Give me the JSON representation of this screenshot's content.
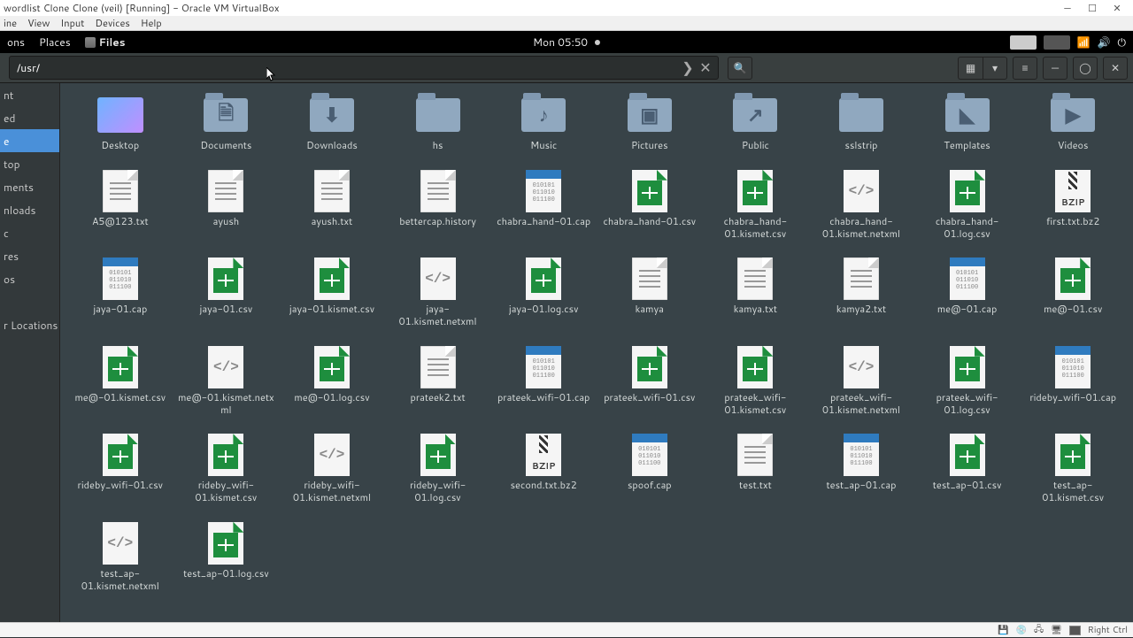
{
  "vb": {
    "title": "wordlist Clone Clone (veil) [Running] - Oracle VM VirtualBox",
    "menus": [
      "ine",
      "View",
      "Input",
      "Devices",
      "Help"
    ],
    "status_right": "Right Ctrl"
  },
  "topbar": {
    "left": [
      "ons",
      "Places",
      "Files"
    ],
    "clock": "Mon 05:50"
  },
  "headerbar": {
    "path_value": "/usr/"
  },
  "sidebar": {
    "items": [
      {
        "label": "nt",
        "sel": false
      },
      {
        "label": "ed",
        "sel": false
      },
      {
        "label": "e",
        "sel": true
      },
      {
        "label": "top",
        "sel": false
      },
      {
        "label": "ments",
        "sel": false
      },
      {
        "label": "nloads",
        "sel": false
      },
      {
        "label": "c",
        "sel": false
      },
      {
        "label": "res",
        "sel": false
      },
      {
        "label": "os",
        "sel": false
      },
      {
        "label": "",
        "sel": false
      },
      {
        "label": "r Locations",
        "sel": false
      }
    ]
  },
  "files": [
    {
      "name": "Desktop",
      "type": "desktop"
    },
    {
      "name": "Documents",
      "type": "folder",
      "glyph": "🗎"
    },
    {
      "name": "Downloads",
      "type": "folder",
      "glyph": "⬇"
    },
    {
      "name": "hs",
      "type": "folder",
      "glyph": ""
    },
    {
      "name": "Music",
      "type": "folder",
      "glyph": "♪"
    },
    {
      "name": "Pictures",
      "type": "folder",
      "glyph": "▣"
    },
    {
      "name": "Public",
      "type": "folder",
      "glyph": "↗"
    },
    {
      "name": "sslstrip",
      "type": "folder",
      "glyph": ""
    },
    {
      "name": "Templates",
      "type": "folder",
      "glyph": "◣"
    },
    {
      "name": "Videos",
      "type": "folder",
      "glyph": "▶"
    },
    {
      "name": "A5@123.txt",
      "type": "doc"
    },
    {
      "name": "ayush",
      "type": "doc"
    },
    {
      "name": "ayush.txt",
      "type": "doc"
    },
    {
      "name": "bettercap.history",
      "type": "doc"
    },
    {
      "name": "chabra_hand-01.cap",
      "type": "cap"
    },
    {
      "name": "chabra_hand-01.csv",
      "type": "sheet"
    },
    {
      "name": "chabra_hand-01.kismet.csv",
      "type": "sheet"
    },
    {
      "name": "chabra_hand-01.kismet.netxml",
      "type": "code"
    },
    {
      "name": "chabra_hand-01.log.csv",
      "type": "sheet"
    },
    {
      "name": "first.txt.bz2",
      "type": "bzip"
    },
    {
      "name": "jaya-01.cap",
      "type": "cap"
    },
    {
      "name": "jaya-01.csv",
      "type": "sheet"
    },
    {
      "name": "jaya-01.kismet.csv",
      "type": "sheet"
    },
    {
      "name": "jaya-01.kismet.netxml",
      "type": "code"
    },
    {
      "name": "jaya-01.log.csv",
      "type": "sheet"
    },
    {
      "name": "kamya",
      "type": "doc"
    },
    {
      "name": "kamya.txt",
      "type": "doc"
    },
    {
      "name": "kamya2.txt",
      "type": "doc"
    },
    {
      "name": "me@-01.cap",
      "type": "cap"
    },
    {
      "name": "me@-01.csv",
      "type": "sheet"
    },
    {
      "name": "me@-01.kismet.csv",
      "type": "sheet"
    },
    {
      "name": "me@-01.kismet.netxml",
      "type": "code"
    },
    {
      "name": "me@-01.log.csv",
      "type": "sheet"
    },
    {
      "name": "prateek2.txt",
      "type": "doc"
    },
    {
      "name": "prateek_wifi-01.cap",
      "type": "cap"
    },
    {
      "name": "prateek_wifi-01.csv",
      "type": "sheet"
    },
    {
      "name": "prateek_wifi-01.kismet.csv",
      "type": "sheet"
    },
    {
      "name": "prateek_wifi-01.kismet.netxml",
      "type": "code"
    },
    {
      "name": "prateek_wifi-01.log.csv",
      "type": "sheet"
    },
    {
      "name": "rideby_wifi-01.cap",
      "type": "cap"
    },
    {
      "name": "rideby_wifi-01.csv",
      "type": "sheet"
    },
    {
      "name": "rideby_wifi-01.kismet.csv",
      "type": "sheet"
    },
    {
      "name": "rideby_wifi-01.kismet.netxml",
      "type": "code"
    },
    {
      "name": "rideby_wifi-01.log.csv",
      "type": "sheet"
    },
    {
      "name": "second.txt.bz2",
      "type": "bzip"
    },
    {
      "name": "spoof.cap",
      "type": "cap"
    },
    {
      "name": "test.txt",
      "type": "doc"
    },
    {
      "name": "test_ap-01.cap",
      "type": "cap"
    },
    {
      "name": "test_ap-01.csv",
      "type": "sheet"
    },
    {
      "name": "test_ap-01.kismet.csv",
      "type": "sheet"
    },
    {
      "name": "test_ap-01.kismet.netxml",
      "type": "code"
    },
    {
      "name": "test_ap-01.log.csv",
      "type": "sheet"
    }
  ]
}
